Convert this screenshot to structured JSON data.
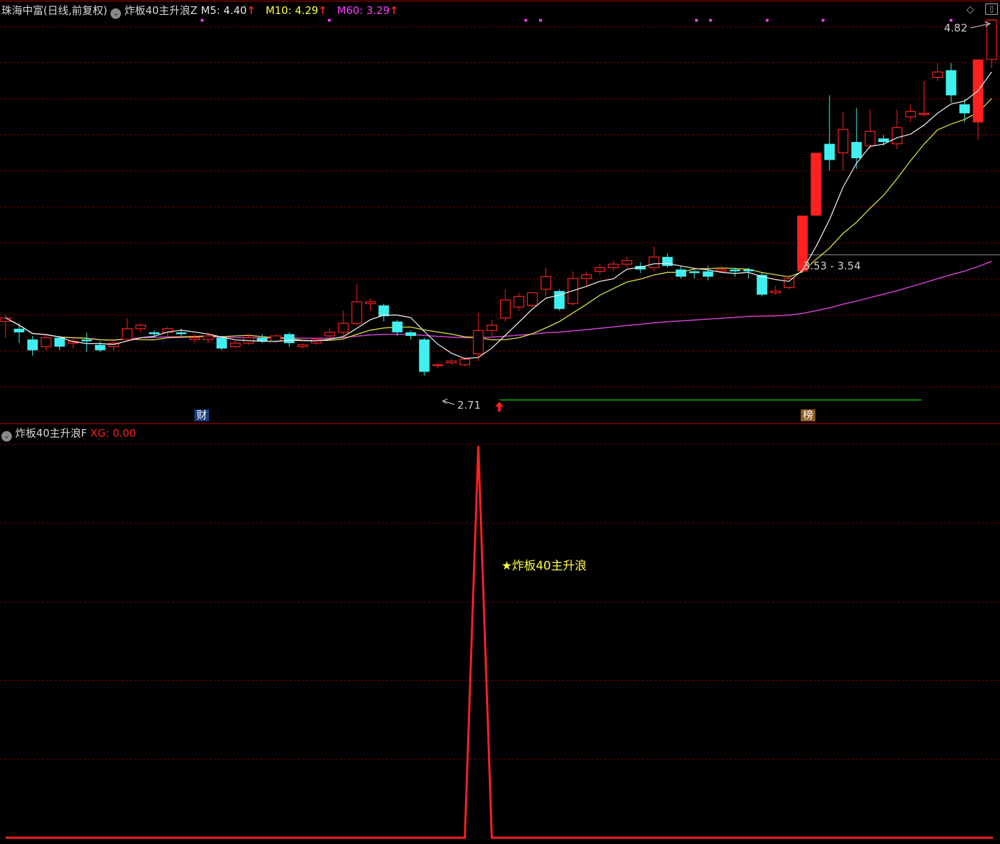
{
  "top_panel": {
    "stock_name": "珠海中富(日线,前复权)",
    "indicator_name": "炸板40主升浪Z",
    "ma5": {
      "label": "M5:",
      "value": "4.40",
      "color": "#e8e8e8"
    },
    "ma10": {
      "label": "M10:",
      "value": "4.29",
      "color": "#ffff40"
    },
    "ma60": {
      "label": "M60:",
      "value": "3.29",
      "color": "#ff40ff"
    },
    "arrow_glyph": "↑",
    "high_label": "4.82",
    "low_label": "2.71",
    "band_label": "3.53 - 3.54",
    "badge_finance": "财",
    "badge_rank": "榜",
    "diamond_icon": "◇",
    "window_icon": "▯"
  },
  "bottom_panel": {
    "indicator_name": "炸板40主升浪F",
    "xg_label": "XG:",
    "xg_value": "0.00",
    "signal_label": "★炸板40主升浪",
    "xg_color": "#ff2020"
  },
  "colors": {
    "up": "#ff2020",
    "down": "#40f0f0",
    "grid": "#7a0000",
    "ma60": "#d040d0",
    "ma10": "#e0e040",
    "ma5": "#e8e8e8",
    "support": "#00d000"
  },
  "chart_data": {
    "type": "candlestick",
    "ylim": [
      2.6,
      4.9
    ],
    "candles": [
      [
        3.14,
        3.16,
        3.05,
        3.18
      ],
      [
        3.1,
        3.08,
        3.02,
        3.13
      ],
      [
        3.04,
        2.98,
        2.95,
        3.06
      ],
      [
        3.0,
        3.05,
        2.98,
        3.07
      ],
      [
        3.05,
        3.0,
        2.98,
        3.06
      ],
      [
        3.02,
        3.03,
        2.99,
        3.05
      ],
      [
        3.04,
        3.03,
        2.97,
        3.08
      ],
      [
        3.01,
        2.98,
        2.97,
        3.03
      ],
      [
        3.0,
        3.02,
        2.98,
        3.03
      ],
      [
        3.04,
        3.1,
        3.03,
        3.16
      ],
      [
        3.1,
        3.12,
        3.08,
        3.13
      ],
      [
        3.08,
        3.07,
        3.05,
        3.09
      ],
      [
        3.08,
        3.1,
        3.05,
        3.11
      ],
      [
        3.08,
        3.07,
        3.06,
        3.1
      ],
      [
        3.04,
        3.05,
        3.02,
        3.07
      ],
      [
        3.04,
        3.06,
        3.02,
        3.08
      ],
      [
        3.05,
        2.99,
        2.98,
        3.06
      ],
      [
        3.0,
        3.02,
        2.99,
        3.04
      ],
      [
        3.02,
        3.05,
        3.01,
        3.07
      ],
      [
        3.05,
        3.03,
        3.02,
        3.07
      ],
      [
        3.03,
        3.06,
        3.02,
        3.07
      ],
      [
        3.07,
        3.02,
        3.0,
        3.08
      ],
      [
        3.0,
        3.01,
        2.99,
        3.02
      ],
      [
        3.02,
        3.04,
        3.01,
        3.05
      ],
      [
        3.06,
        3.08,
        3.05,
        3.1
      ],
      [
        3.08,
        3.13,
        3.06,
        3.2
      ],
      [
        3.13,
        3.25,
        3.12,
        3.35
      ],
      [
        3.24,
        3.25,
        3.2,
        3.27
      ],
      [
        3.23,
        3.17,
        3.14,
        3.24
      ],
      [
        3.14,
        3.08,
        3.06,
        3.15
      ],
      [
        3.08,
        3.06,
        3.04,
        3.09
      ],
      [
        3.04,
        2.86,
        2.84,
        3.05
      ],
      [
        2.9,
        2.9,
        2.88,
        2.91
      ],
      [
        2.91,
        2.92,
        2.9,
        2.93
      ],
      [
        2.9,
        2.93,
        2.89,
        2.94
      ],
      [
        2.96,
        3.09,
        2.92,
        3.19
      ],
      [
        3.09,
        3.12,
        3.05,
        3.15
      ],
      [
        3.16,
        3.26,
        3.14,
        3.32
      ],
      [
        3.22,
        3.28,
        3.2,
        3.3
      ],
      [
        3.23,
        3.3,
        3.22,
        3.3
      ],
      [
        3.32,
        3.39,
        3.28,
        3.44
      ],
      [
        3.31,
        3.21,
        3.2,
        3.32
      ],
      [
        3.24,
        3.38,
        3.23,
        3.42
      ],
      [
        3.38,
        3.4,
        3.34,
        3.42
      ],
      [
        3.42,
        3.44,
        3.4,
        3.46
      ],
      [
        3.44,
        3.46,
        3.42,
        3.48
      ],
      [
        3.46,
        3.48,
        3.44,
        3.5
      ],
      [
        3.45,
        3.43,
        3.41,
        3.47
      ],
      [
        3.44,
        3.5,
        3.42,
        3.56
      ],
      [
        3.5,
        3.45,
        3.44,
        3.52
      ],
      [
        3.43,
        3.39,
        3.38,
        3.45
      ],
      [
        3.42,
        3.41,
        3.38,
        3.43
      ],
      [
        3.42,
        3.39,
        3.37,
        3.45
      ],
      [
        3.42,
        3.43,
        3.41,
        3.45
      ],
      [
        3.43,
        3.42,
        3.39,
        3.44
      ],
      [
        3.43,
        3.42,
        3.38,
        3.44
      ],
      [
        3.4,
        3.29,
        3.28,
        3.41
      ],
      [
        3.3,
        3.31,
        3.29,
        3.34
      ],
      [
        3.33,
        3.38,
        3.32,
        3.4
      ],
      [
        3.42,
        3.73,
        3.42,
        3.73
      ],
      [
        3.73,
        4.08,
        3.73,
        4.08
      ],
      [
        4.13,
        4.04,
        3.98,
        4.4
      ],
      [
        4.08,
        4.21,
        3.98,
        4.31
      ],
      [
        4.14,
        4.05,
        3.99,
        4.33
      ],
      [
        4.12,
        4.2,
        4.1,
        4.32
      ],
      [
        4.16,
        4.14,
        4.12,
        4.18
      ],
      [
        4.13,
        4.22,
        4.1,
        4.32
      ],
      [
        4.28,
        4.31,
        4.25,
        4.35
      ],
      [
        4.3,
        4.3,
        4.28,
        4.48
      ],
      [
        4.5,
        4.53,
        4.48,
        4.58
      ],
      [
        4.54,
        4.4,
        4.36,
        4.58
      ],
      [
        4.35,
        4.3,
        4.25,
        4.38
      ],
      [
        4.25,
        4.6,
        4.15,
        4.6
      ],
      [
        4.6,
        4.82,
        4.55,
        4.82
      ]
    ],
    "xg_signal_index": 35
  }
}
